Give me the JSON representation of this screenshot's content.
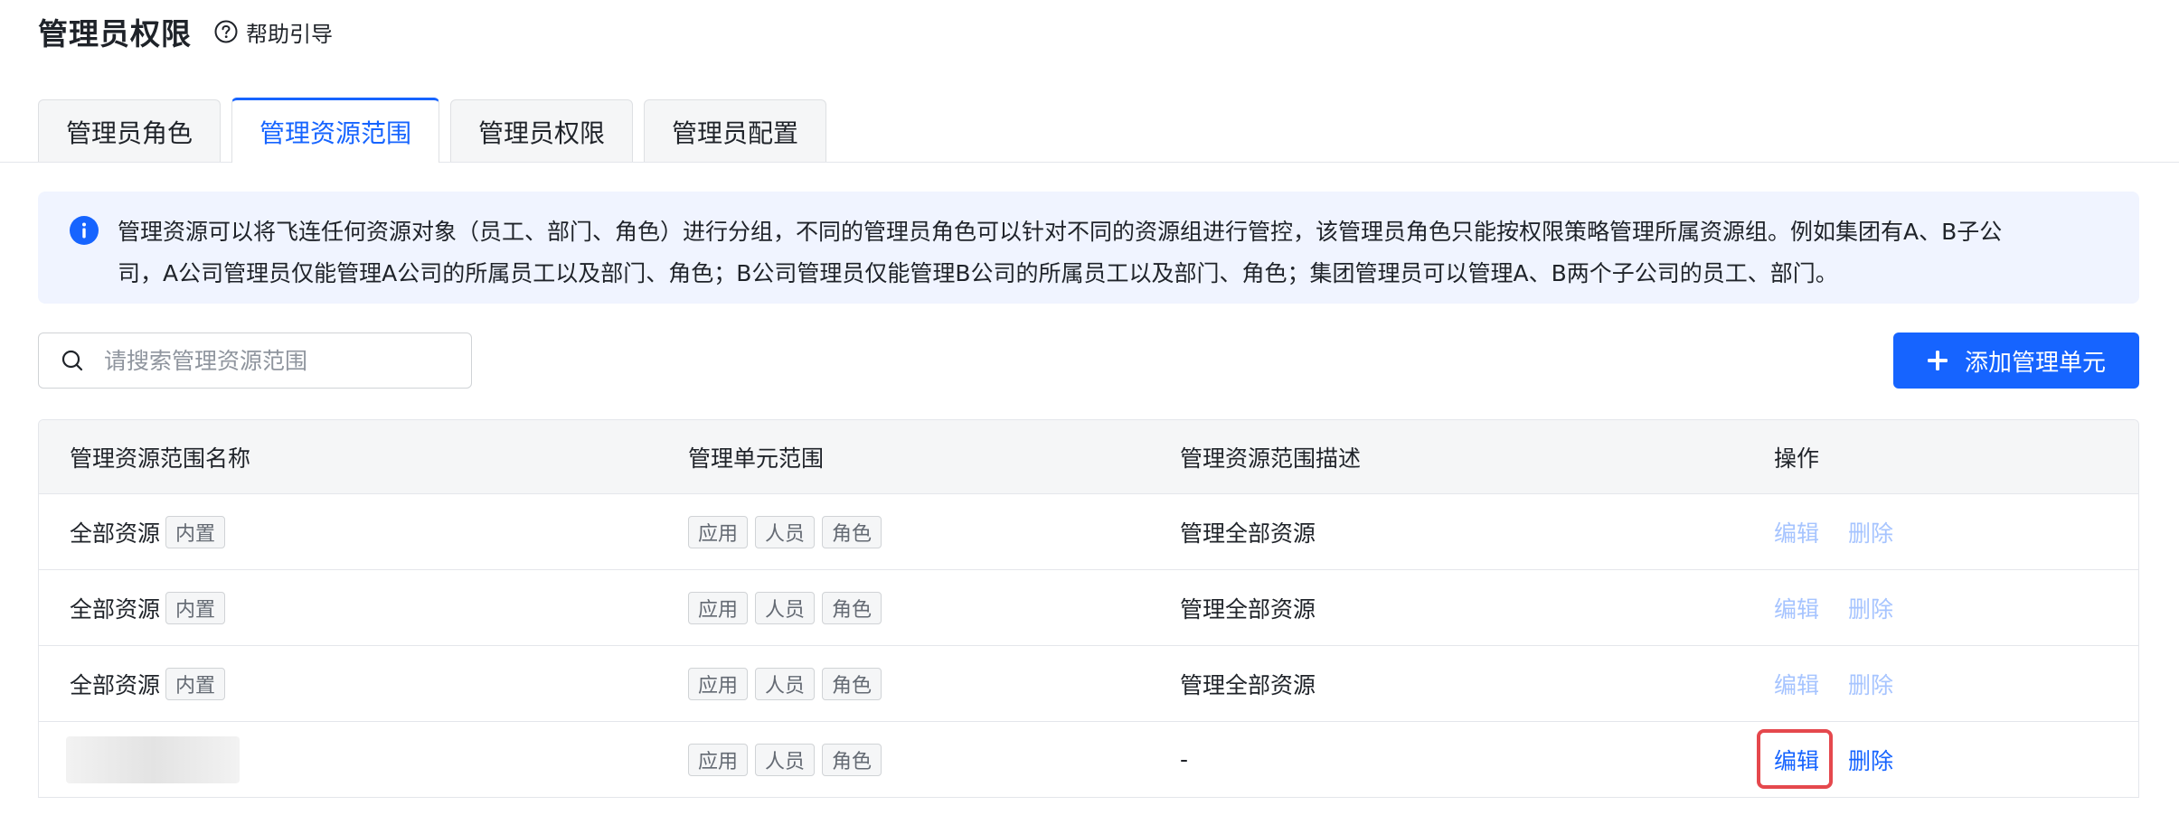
{
  "header": {
    "title": "管理员权限",
    "help_label": "帮助引导"
  },
  "tabs": [
    {
      "label": "管理员角色",
      "active": false
    },
    {
      "label": "管理资源范围",
      "active": true
    },
    {
      "label": "管理员权限",
      "active": false
    },
    {
      "label": "管理员配置",
      "active": false
    }
  ],
  "info": {
    "line1": "管理资源可以将飞连任何资源对象（员工、部门、角色）进行分组，不同的管理员角色可以针对不同的资源组进行管控，该管理员角色只能按权限策略管理所属资源组。例如集团有A、B子公",
    "line2": "司，A公司管理员仅能管理A公司的所属员工以及部门、角色；B公司管理员仅能管理B公司的所属员工以及部门、角色；集团管理员可以管理A、B两个子公司的员工、部门。"
  },
  "search": {
    "placeholder": "请搜索管理资源范围",
    "value": ""
  },
  "toolbar": {
    "add_label": "添加管理单元"
  },
  "table": {
    "columns": [
      "管理资源范围名称",
      "管理单元范围",
      "管理资源范围描述",
      "操作"
    ],
    "rows": [
      {
        "name": "全部资源",
        "badge": "内置",
        "scopes": [
          "应用",
          "人员",
          "角色"
        ],
        "description": "管理全部资源",
        "edit": "编辑",
        "delete": "删除"
      },
      {
        "name": "全部资源",
        "badge": "内置",
        "scopes": [
          "应用",
          "人员",
          "角色"
        ],
        "description": "管理全部资源",
        "edit": "编辑",
        "delete": "删除"
      },
      {
        "name": "全部资源",
        "badge": "内置",
        "scopes": [
          "应用",
          "人员",
          "角色"
        ],
        "description": "管理全部资源",
        "edit": "编辑",
        "delete": "删除"
      },
      {
        "name": "",
        "badge": "",
        "scopes": [
          "应用",
          "人员",
          "角色"
        ],
        "description": "-",
        "edit": "编辑",
        "delete": "删除"
      }
    ]
  },
  "colors": {
    "primary": "#1664ff",
    "disabled_link": "#a6c4ff",
    "highlight": "#e5484d",
    "info_bg": "#f0f4ff"
  },
  "icons": {
    "help": "question-circle-icon",
    "info": "info-circle-icon",
    "search": "search-icon",
    "add": "plus-icon"
  }
}
